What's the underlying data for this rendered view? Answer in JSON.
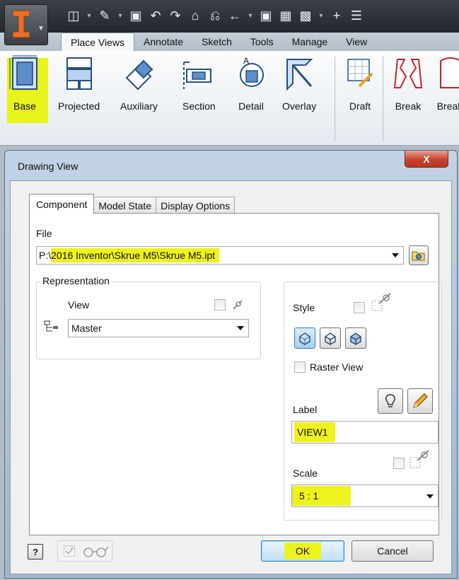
{
  "quick_access_icons": [
    "new-icon",
    "open-icon",
    "save-icon",
    "undo-icon",
    "redo-icon",
    "home-icon",
    "print-icon",
    "return-icon",
    "update-icon",
    "measure-icon",
    "material-icon",
    "add-icon",
    "customize-icon"
  ],
  "ribbon": {
    "tabs": [
      {
        "label": "Place Views",
        "active": true
      },
      {
        "label": "Annotate"
      },
      {
        "label": "Sketch"
      },
      {
        "label": "Tools"
      },
      {
        "label": "Manage"
      },
      {
        "label": "View"
      }
    ],
    "buttons": {
      "base": "Base",
      "projected": "Projected",
      "auxiliary": "Auxiliary",
      "section": "Section",
      "detail": "Detail",
      "overlay": "Overlay",
      "draft": "Draft",
      "break": "Break",
      "break_out": "Break"
    }
  },
  "dialog": {
    "title": "Drawing View",
    "close_label": "X",
    "tabs": [
      "Component",
      "Model State",
      "Display Options"
    ],
    "active_tab": "Component",
    "file": {
      "label": "File",
      "prefix": "P:\\",
      "path_highlighted": "2016 Inventor\\Skrue M5\\Skrue M5.ipt"
    },
    "representation": {
      "group_label": "Representation",
      "view_label": "View",
      "view_value": "Master"
    },
    "style": {
      "label": "Style",
      "raster_view_label": "Raster View"
    },
    "label_field": {
      "label": "Label",
      "value": "VIEW1"
    },
    "scale": {
      "label": "Scale",
      "value": "5 : 1"
    },
    "buttons": {
      "help": "?",
      "ok": "OK",
      "cancel": "Cancel"
    }
  },
  "colors": {
    "highlight": "#eef21d",
    "dialog_title_bar": "#b3c7dd",
    "close_button": "#c7442b"
  }
}
